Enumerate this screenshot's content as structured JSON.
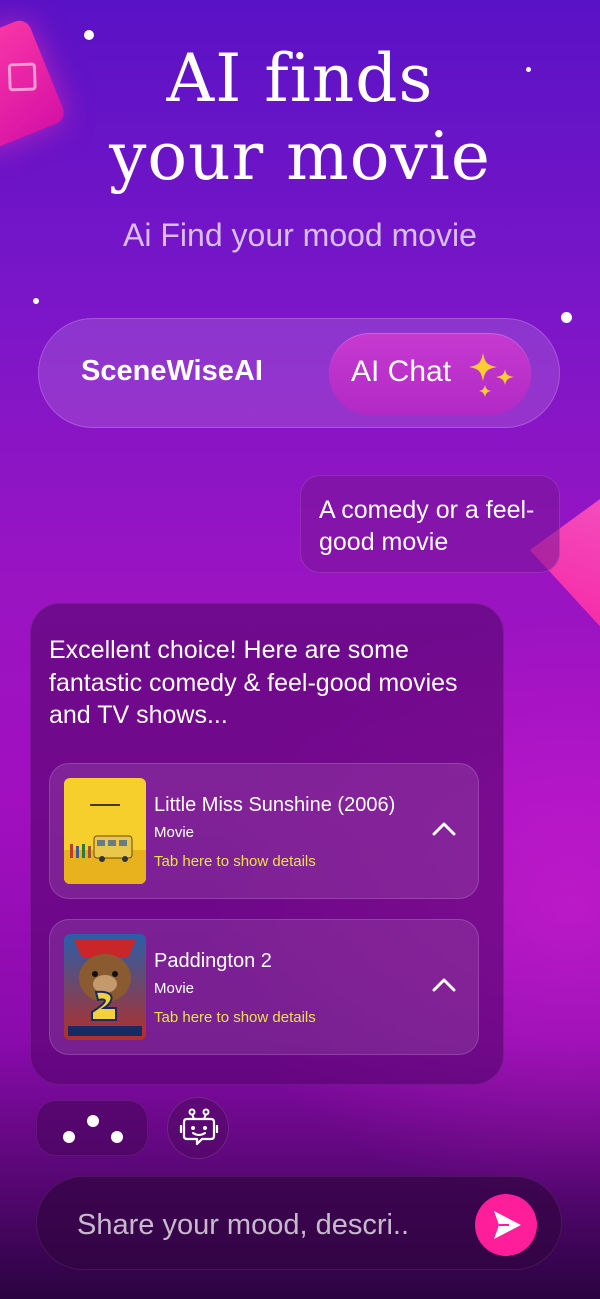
{
  "header": {
    "title_line1": "AI finds",
    "title_line2": "your movie",
    "subtitle": "Ai Find your mood movie"
  },
  "tabs": {
    "brand_label": "SceneWiseAI",
    "chat_label": "AI Chat"
  },
  "chat": {
    "user_message": "A comedy or a feel-good movie",
    "ai_message": "Excellent choice! Here are some fantastic comedy & feel-good movies and TV shows...",
    "movies": [
      {
        "title": "Little Miss Sunshine (2006)",
        "type": "Movie",
        "hint": "Tab here to show details"
      },
      {
        "title": "Paddington 2",
        "type": "Movie",
        "hint": "Tab here to show details"
      }
    ]
  },
  "composer": {
    "placeholder": "Share your mood, descri.."
  },
  "colors": {
    "accent": "#ff1e9a",
    "hint": "#e8e34a",
    "sparkle": "#ffcc33"
  },
  "icons": {
    "tab_chat": "sparkles-icon",
    "typing": "typing-dots-icon",
    "bot": "robot-icon",
    "send": "send-icon",
    "expand": "chevron-up-icon"
  }
}
